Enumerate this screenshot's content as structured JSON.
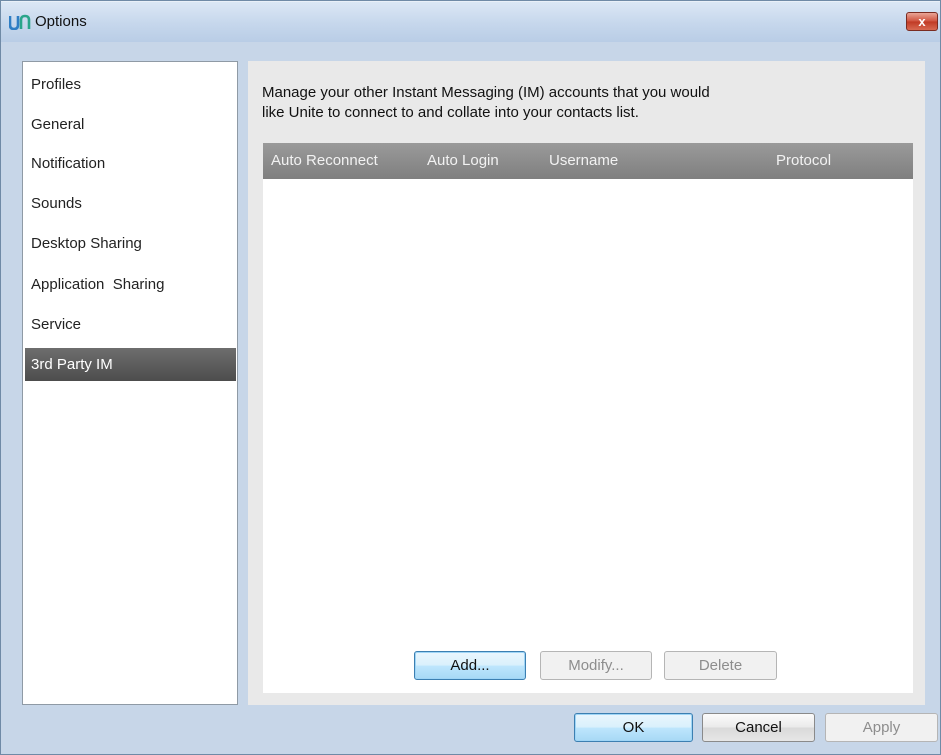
{
  "window": {
    "title": "Options",
    "close_glyph": "x"
  },
  "icons": {
    "app_logo": "unite-logo-icon",
    "close": "close-icon"
  },
  "colors": {
    "selected_nav_bg": "#555555",
    "list_header_bg": "#8a8a8a",
    "default_button_border": "#3c7fb1",
    "close_button_red": "#c9442e"
  },
  "nav": {
    "items": [
      {
        "label": "Profiles",
        "selected": false
      },
      {
        "label": "General",
        "selected": false
      },
      {
        "label": "Notification",
        "selected": false
      },
      {
        "label": "Sounds",
        "selected": false
      },
      {
        "label": "Desktop Sharing",
        "selected": false
      },
      {
        "label": "Application  Sharing",
        "selected": false
      },
      {
        "label": "Service",
        "selected": false
      },
      {
        "label": "3rd Party IM",
        "selected": true
      }
    ]
  },
  "main": {
    "description_line1": "Manage your other Instant Messaging (IM) accounts that you would",
    "description_line2": "like Unite to connect to and collate into your contacts list.",
    "columns": [
      "Auto Reconnect",
      "Auto Login",
      "Username",
      "Protocol"
    ],
    "rows": [],
    "buttons": {
      "add": "Add...",
      "modify": "Modify...",
      "delete": "Delete"
    }
  },
  "footer": {
    "ok": "OK",
    "cancel": "Cancel",
    "apply": "Apply"
  }
}
